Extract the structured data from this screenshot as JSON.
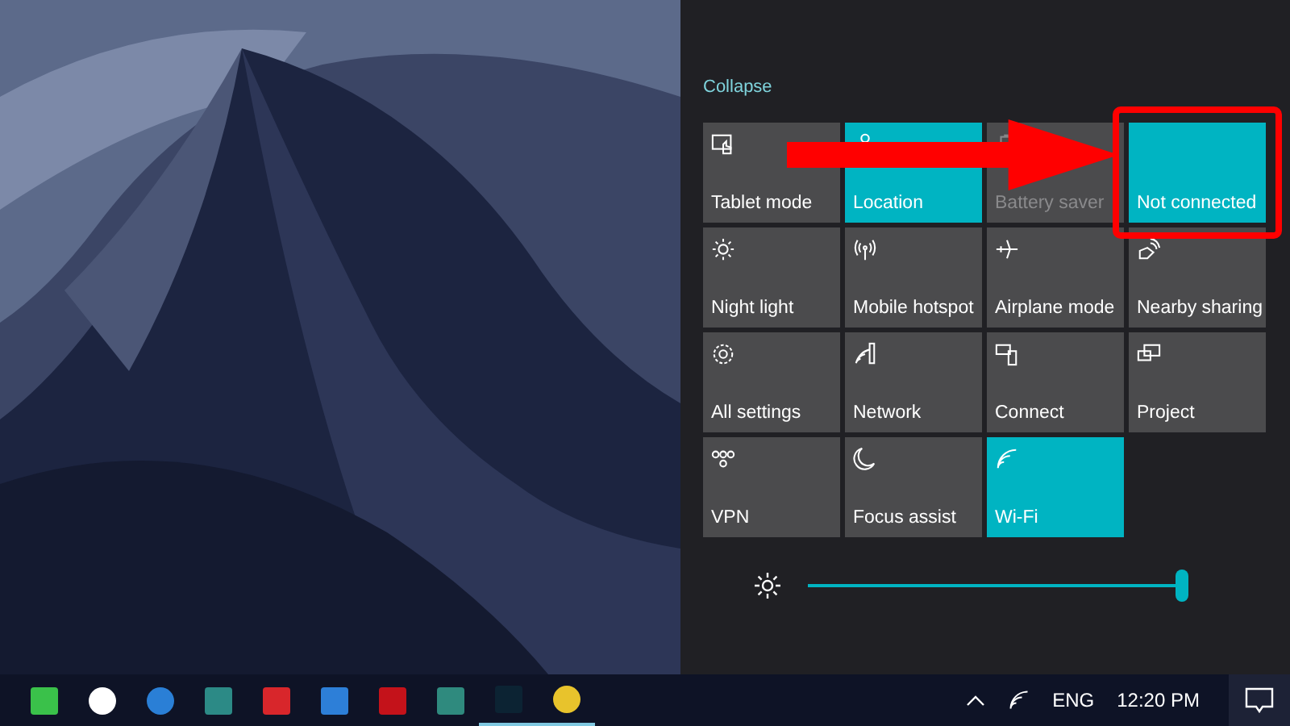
{
  "action_center": {
    "collapse_link": "Collapse",
    "tiles": [
      {
        "label": "Tablet mode",
        "on": false,
        "disabled": false
      },
      {
        "label": "Location",
        "on": true,
        "disabled": false
      },
      {
        "label": "Battery saver",
        "on": false,
        "disabled": true
      },
      {
        "label": "Not connected",
        "on": true,
        "disabled": false
      },
      {
        "label": "Night light",
        "on": false,
        "disabled": false
      },
      {
        "label": "Mobile hotspot",
        "on": false,
        "disabled": false
      },
      {
        "label": "Airplane mode",
        "on": false,
        "disabled": false
      },
      {
        "label": "Nearby sharing",
        "on": false,
        "disabled": false
      },
      {
        "label": "All settings",
        "on": false,
        "disabled": false
      },
      {
        "label": "Network",
        "on": false,
        "disabled": false
      },
      {
        "label": "Connect",
        "on": false,
        "disabled": false
      },
      {
        "label": "Project",
        "on": false,
        "disabled": false
      },
      {
        "label": "VPN",
        "on": false,
        "disabled": false
      },
      {
        "label": "Focus assist",
        "on": false,
        "disabled": false
      },
      {
        "label": "Wi-Fi",
        "on": true,
        "disabled": false
      }
    ],
    "brightness": {
      "level": 1
    }
  },
  "taskbar": {
    "apps": [
      {
        "running": false
      },
      {
        "running": false
      },
      {
        "running": false
      },
      {
        "running": false
      },
      {
        "running": false
      },
      {
        "running": false
      },
      {
        "running": false
      },
      {
        "running": false
      },
      {
        "running": true
      },
      {
        "running": true
      }
    ],
    "language": "ENG",
    "time": "12:20 PM"
  }
}
